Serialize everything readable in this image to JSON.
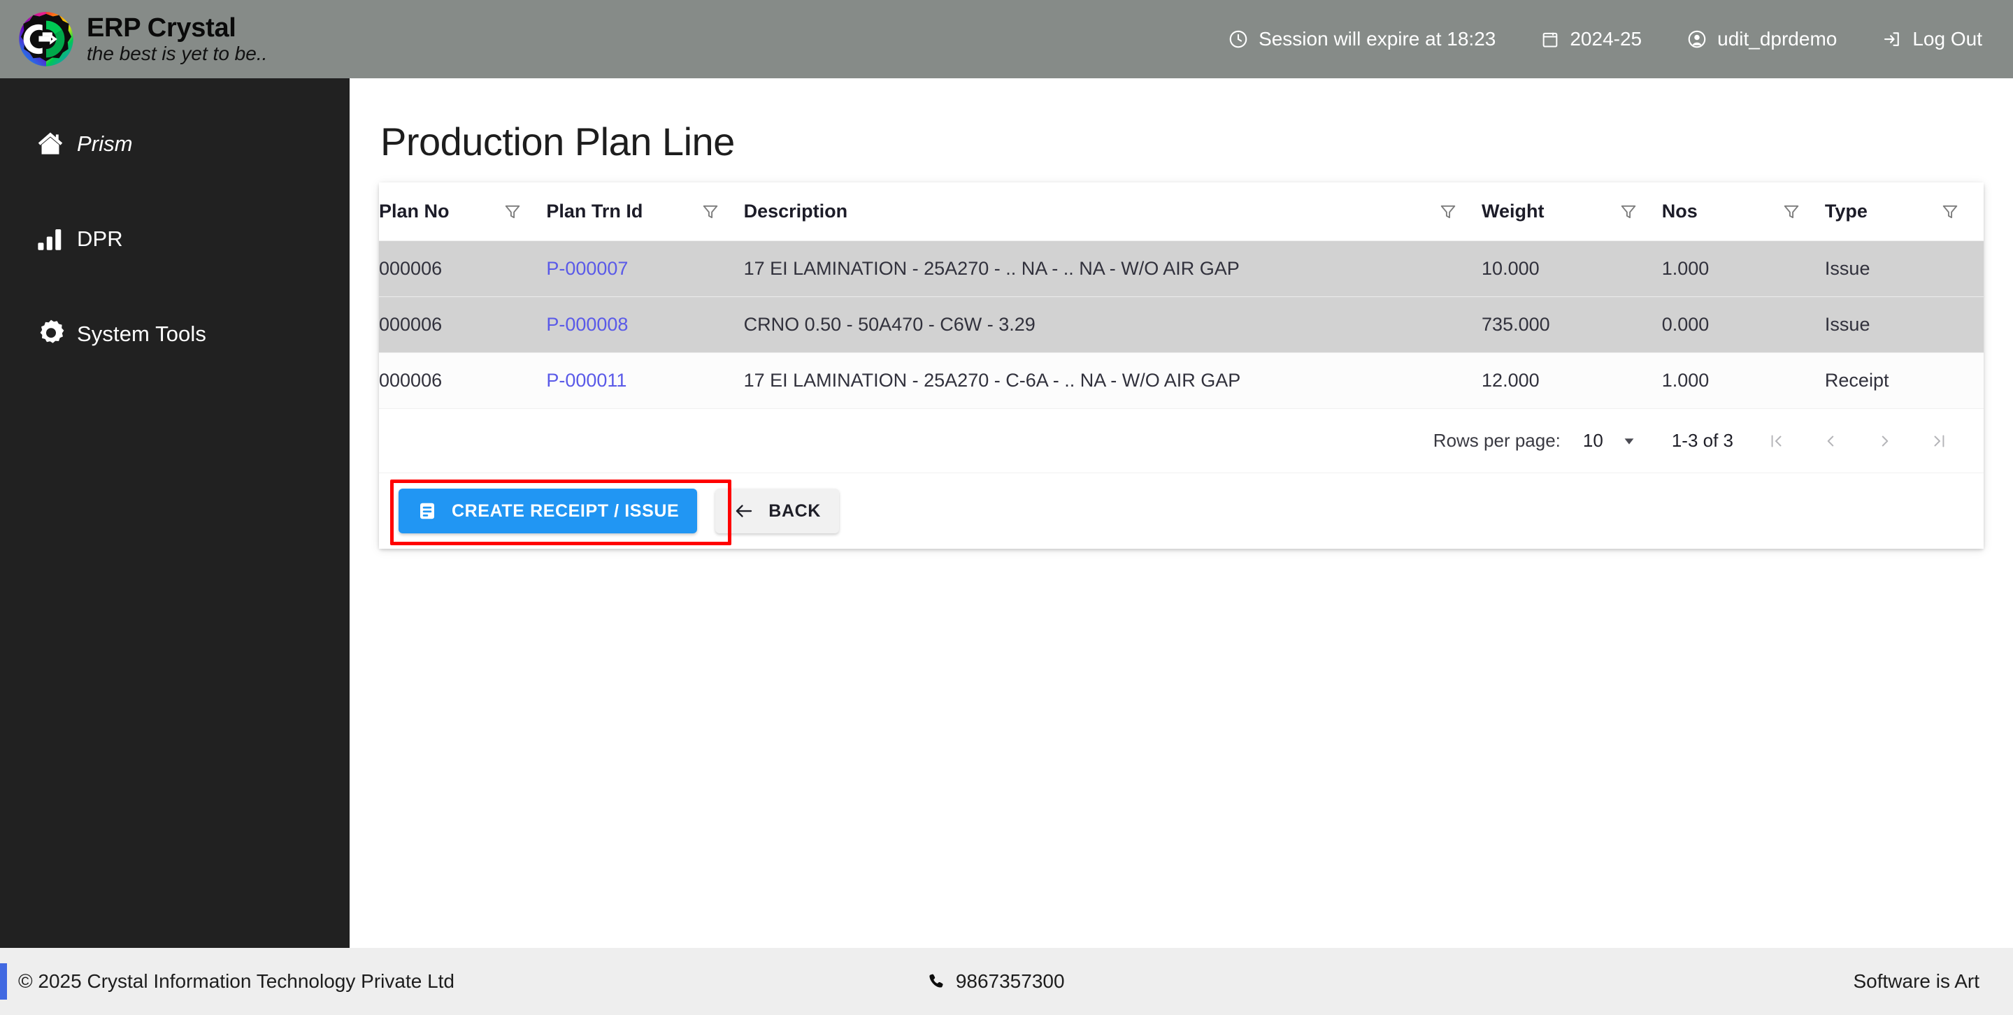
{
  "header": {
    "brand_title": "ERP Crystal",
    "brand_tagline": "the best is yet to be..",
    "logo_icon": "erp-crystal-logo",
    "items": [
      {
        "icon": "clock-icon",
        "label": "Session will expire at 18:23"
      },
      {
        "icon": "calendar-icon",
        "label": "2024-25"
      },
      {
        "icon": "user-icon",
        "label": "udit_dprdemo"
      },
      {
        "icon": "logout-icon",
        "label": "Log Out"
      }
    ]
  },
  "sidebar": {
    "items": [
      {
        "icon": "home-icon",
        "label": "Prism",
        "italic": true
      },
      {
        "icon": "bar-chart-icon",
        "label": "DPR",
        "italic": false
      },
      {
        "icon": "gear-icon",
        "label": "System Tools",
        "italic": false
      }
    ]
  },
  "main": {
    "page_title": "Production Plan Line",
    "table": {
      "filter_icon": "funnel-icon",
      "columns": [
        {
          "key": "plan_no",
          "label": "Plan No"
        },
        {
          "key": "plan_trn_id",
          "label": "Plan Trn Id"
        },
        {
          "key": "description",
          "label": "Description"
        },
        {
          "key": "weight",
          "label": "Weight"
        },
        {
          "key": "nos",
          "label": "Nos"
        },
        {
          "key": "type",
          "label": "Type"
        }
      ],
      "rows": [
        {
          "plan_no": "000006",
          "plan_trn_id": "P-000007",
          "description": "17 EI LAMINATION - 25A270 - .. NA - .. NA - W/O AIR GAP",
          "weight": "10.000",
          "nos": "1.000",
          "type": "Issue",
          "selected": true
        },
        {
          "plan_no": "000006",
          "plan_trn_id": "P-000008",
          "description": "CRNO 0.50 - 50A470 - C6W - 3.29",
          "weight": "735.000",
          "nos": "0.000",
          "type": "Issue",
          "selected": true
        },
        {
          "plan_no": "000006",
          "plan_trn_id": "P-000011",
          "description": "17 EI LAMINATION - 25A270 - C-6A - .. NA - W/O AIR GAP",
          "weight": "12.000",
          "nos": "1.000",
          "type": "Receipt",
          "selected": false
        }
      ]
    },
    "paginator": {
      "rows_per_page_label": "Rows per page:",
      "rows_per_page_value": "10",
      "range_label": "1-3 of 3",
      "first_page_icon": "first-page-icon",
      "prev_page_icon": "previous-page-icon",
      "next_page_icon": "next-page-icon",
      "last_page_icon": "last-page-icon"
    },
    "actions": {
      "create_label": "CREATE RECEIPT / ISSUE",
      "create_icon": "document-list-icon",
      "back_label": "BACK",
      "back_icon": "arrow-left-icon",
      "highlight_color": "#ff0000"
    }
  },
  "footer": {
    "copyright": "© 2025 Crystal Information Technology Private Ltd",
    "phone_icon": "phone-icon",
    "phone": "9867357300",
    "tagline": "Software is Art"
  },
  "colors": {
    "header_bg": "#868b88",
    "sidebar_bg": "#212121",
    "primary_button": "#2196f3",
    "link": "#5a5ae8",
    "selected_row": "#d2d2d2",
    "footer_bg": "#eeeeee",
    "footer_accent": "#4169e1"
  }
}
